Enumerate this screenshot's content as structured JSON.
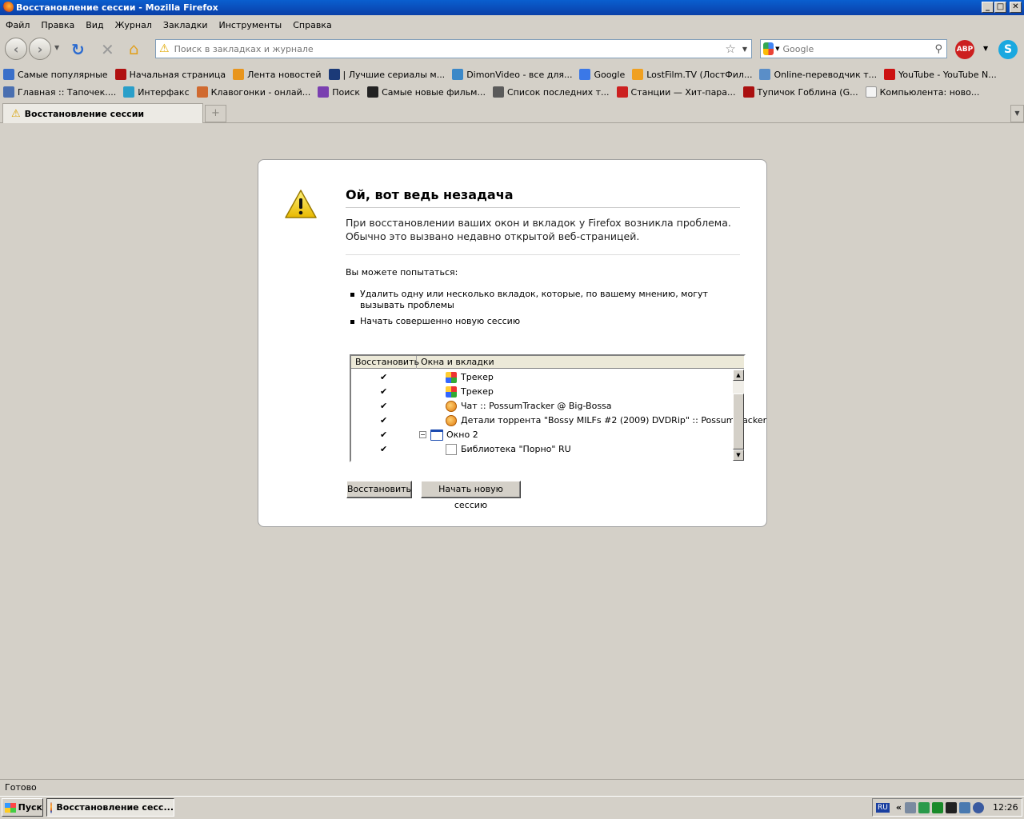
{
  "window": {
    "title": "Восстановление сессии - Mozilla Firefox",
    "min": "_",
    "max": "□",
    "close": "✕"
  },
  "menu": [
    "Файл",
    "Правка",
    "Вид",
    "Журнал",
    "Закладки",
    "Инструменты",
    "Справка"
  ],
  "nav": {
    "url_placeholder": "Поиск в закладках и журнале",
    "search_placeholder": "Google",
    "abp_label": "ABP"
  },
  "bookmarks_row1": [
    {
      "label": "Самые популярные",
      "color": "#3a6fc9"
    },
    {
      "label": "Начальная страница",
      "color": "#b01010"
    },
    {
      "label": "Лента новостей",
      "color": "#e8951c"
    },
    {
      "label": "| Лучшие сериалы м...",
      "color": "#1b3a78"
    },
    {
      "label": "DimonVideo - все для...",
      "color": "#3b88c8"
    },
    {
      "label": "Google",
      "color": "#3b78e7"
    },
    {
      "label": "LostFilm.TV (ЛостФил...",
      "color": "#f0a020"
    },
    {
      "label": "Online-переводчик т...",
      "color": "#5a8ec8"
    },
    {
      "label": "YouTube - YouTube N...",
      "color": "#cc1111"
    }
  ],
  "bookmarks_row2": [
    {
      "label": "Главная :: Тапочек....",
      "color": "#4a6fb0"
    },
    {
      "label": "Интерфакс",
      "color": "#2a9fc9"
    },
    {
      "label": "Клавогонки - онлай...",
      "color": "#d06a30"
    },
    {
      "label": "Поиск",
      "color": "#7a3fb0"
    },
    {
      "label": "Самые новые фильм...",
      "color": "#222222"
    },
    {
      "label": "Список последних т...",
      "color": "#5a5a5a"
    },
    {
      "label": "Станции — Хит-пара...",
      "color": "#cc2020"
    },
    {
      "label": "Тупичок Гоблина (G...",
      "color": "#aa1010"
    },
    {
      "label": "Компьюлента: ново...",
      "color": "#f4f4f4"
    }
  ],
  "tab": {
    "label": "Восстановление сессии",
    "newtab": "+",
    "list": "▼"
  },
  "error": {
    "title": "Ой, вот ведь незадача",
    "desc_line1": "При восстановлении ваших окон и вкладок у Firefox возникла проблема.",
    "desc_line2": "Обычно это вызвано недавно открытой веб-страницей.",
    "try": "Вы можете попытаться:",
    "item1": "Удалить одну или несколько вкладок, которые, по вашему мнению, могут вызывать проблемы",
    "item2": "Начать совершенно новую сессию"
  },
  "tree": {
    "col1": "Восстановить",
    "col2": "Окна и вкладки",
    "rows": [
      {
        "check": "✔",
        "label": "Трекер",
        "icon": "tracker"
      },
      {
        "check": "✔",
        "label": "Трекер",
        "icon": "tracker"
      },
      {
        "check": "✔",
        "label": "Чат :: PossumTracker @ Big-Bossa",
        "icon": "possum"
      },
      {
        "check": "✔",
        "label": "Детали торрента \"Bossy MILFs #2 (2009) DVDRip\" :: PossumTracker",
        "icon": "possum"
      },
      {
        "check": "✔",
        "label": "Окно 2",
        "icon": "window",
        "expander": "−"
      },
      {
        "check": "✔",
        "label": "Библиотека \"Порно\" RU",
        "icon": "page"
      }
    ]
  },
  "buttons": {
    "restore": "Восстановить",
    "new_session": "Начать новую сессию"
  },
  "status": "Готово",
  "taskbar": {
    "start": "Пуск",
    "item": "Восстановление сесс...",
    "lang": "RU",
    "arrows": "«",
    "time": "12:26"
  },
  "colors": {
    "titlebar": "#0a4fc0",
    "chrome": "#d4d0c8",
    "panel": "#ffffff",
    "warning": "#f5d21c"
  }
}
